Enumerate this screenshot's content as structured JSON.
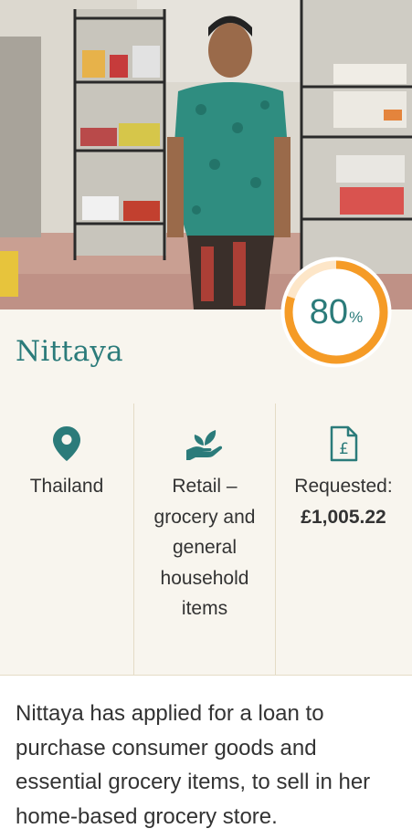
{
  "borrower": {
    "name": "Nittaya",
    "photo_alt": "Borrower photo"
  },
  "progress": {
    "value": 0.8,
    "number": "80",
    "suffix": "%"
  },
  "details": {
    "location": "Thailand",
    "sector": "Retail – grocery and general household items",
    "requested_label": "Requested:",
    "requested_amount": "£1,005.22"
  },
  "description": "Nittaya has applied for a loan to purchase consumer goods and essential grocery items, to sell in her home-based grocery store.",
  "icons": {
    "location": "location-pin-icon",
    "sector": "hand-plant-icon",
    "requested": "pound-document-icon"
  },
  "colors": {
    "accent": "#2b7b7a",
    "progress": "#f59b26",
    "band": "#f8f5ee"
  }
}
